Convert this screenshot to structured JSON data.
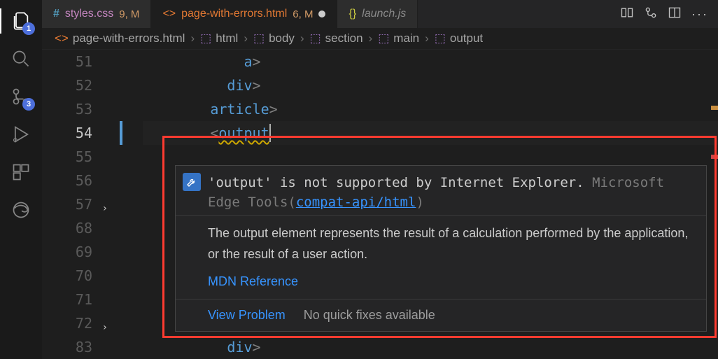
{
  "activity": {
    "explorer_badge": "1",
    "scm_badge": "3"
  },
  "tabs": [
    {
      "icon": "hash",
      "label": "styles.css",
      "meta": "9, M",
      "color_label": "#c586c0",
      "color_meta_a": "#f14c4c",
      "color_meta_b": "#d19a66",
      "dirty": false,
      "italic": false
    },
    {
      "icon": "code",
      "label": "page-with-errors.html",
      "meta": "6, M",
      "color_label": "#e37933",
      "color_meta_a": "#f14c4c",
      "color_meta_b": "#d19a66",
      "dirty": true,
      "italic": false
    },
    {
      "icon": "braces",
      "label": "launch.js",
      "meta": "",
      "color_label": "#8a8a8a",
      "dirty": false,
      "italic": true
    }
  ],
  "breadcrumb": {
    "file_icon": "code",
    "file": "page-with-errors.html",
    "path": [
      "html",
      "body",
      "section",
      "main",
      "output"
    ]
  },
  "code": {
    "lines": [
      {
        "n": "51",
        "indent": 12,
        "open": "</",
        "tag": "a",
        "close": ">"
      },
      {
        "n": "52",
        "indent": 10,
        "open": "</",
        "tag": "div",
        "close": ">"
      },
      {
        "n": "53",
        "indent": 8,
        "open": "</",
        "tag": "article",
        "close": ">"
      },
      {
        "n": "54",
        "indent": 8,
        "open": "<",
        "tag": "output",
        "close": "",
        "warn": true,
        "cursor": true,
        "current": true
      },
      {
        "n": "55",
        "indent": 0,
        "open": "",
        "tag": "",
        "close": ""
      },
      {
        "n": "56",
        "indent": 0,
        "open": "",
        "tag": "",
        "close": ""
      },
      {
        "n": "57",
        "indent": 0,
        "open": "",
        "tag": "",
        "close": "",
        "fold": true
      },
      {
        "n": "68",
        "indent": 0,
        "open": "",
        "tag": "",
        "close": ""
      },
      {
        "n": "69",
        "indent": 10,
        "open": "<",
        "tag": "",
        "close": ""
      },
      {
        "n": "70",
        "indent": 10,
        "open": "<",
        "tag": "",
        "close": ""
      },
      {
        "n": "71",
        "indent": 0,
        "open": "",
        "tag": "",
        "close": ""
      },
      {
        "n": "72",
        "indent": 0,
        "open": "",
        "tag": "",
        "close": "",
        "fold": true
      },
      {
        "n": "83",
        "indent": 10,
        "open": "</",
        "tag": "div",
        "close": ">"
      }
    ]
  },
  "hover": {
    "message_pre": "'output' is not supported by Internet Explorer.",
    "source": "Microsoft Edge Tools",
    "rule_open": "(",
    "rule": "compat-api/html",
    "rule_close": ")",
    "description": "The output element represents the result of a calculation performed by the application, or the result of a user action.",
    "mdn": "MDN Reference",
    "view_problem": "View Problem",
    "no_quick_fix": "No quick fixes available"
  }
}
